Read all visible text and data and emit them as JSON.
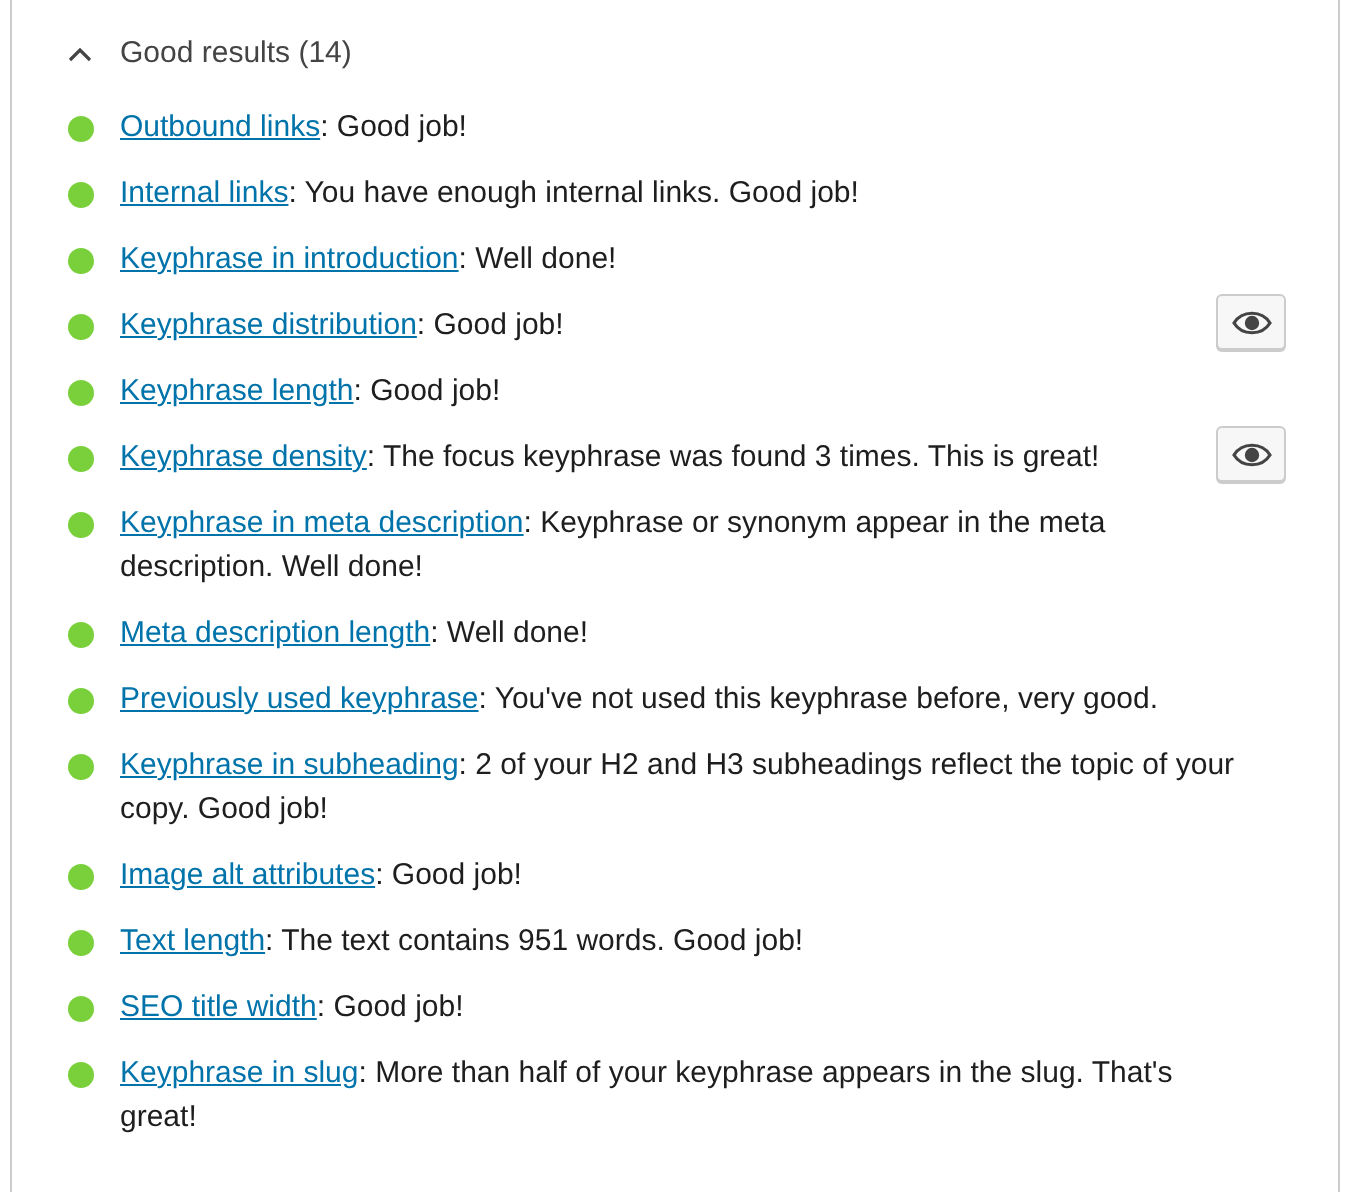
{
  "section": {
    "title": "Good results (14)",
    "expanded": true
  },
  "results": [
    {
      "link": "Outbound links",
      "text": ": Good job!",
      "color": "#7ad03a",
      "eye_button": false
    },
    {
      "link": "Internal links",
      "text": ": You have enough internal links. Good job!",
      "color": "#7ad03a",
      "eye_button": false
    },
    {
      "link": "Keyphrase in introduction",
      "text": ": Well done!",
      "color": "#7ad03a",
      "eye_button": false
    },
    {
      "link": "Keyphrase distribution",
      "text": ": Good job!",
      "color": "#7ad03a",
      "eye_button": true
    },
    {
      "link": "Keyphrase length",
      "text": ": Good job!",
      "color": "#7ad03a",
      "eye_button": false
    },
    {
      "link": "Keyphrase density",
      "text": ": The focus keyphrase was found 3 times. This is great!",
      "color": "#7ad03a",
      "eye_button": true
    },
    {
      "link": "Keyphrase in meta description",
      "text": ": Keyphrase or synonym appear in the meta description. Well done!",
      "color": "#7ad03a",
      "eye_button": false
    },
    {
      "link": "Meta description length",
      "text": ": Well done!",
      "color": "#7ad03a",
      "eye_button": false
    },
    {
      "link": "Previously used keyphrase",
      "text": ": You've not used this keyphrase before, very good.",
      "color": "#7ad03a",
      "eye_button": false
    },
    {
      "link": "Keyphrase in subheading",
      "text": ": 2 of your H2 and H3 subheadings reflect the topic of your copy. Good job!",
      "color": "#7ad03a",
      "eye_button": false
    },
    {
      "link": "Image alt attributes",
      "text": ": Good job!",
      "color": "#7ad03a",
      "eye_button": false
    },
    {
      "link": "Text length",
      "text": ": The text contains 951 words. Good job!",
      "color": "#7ad03a",
      "eye_button": false
    },
    {
      "link": "SEO title width",
      "text": ": Good job!",
      "color": "#7ad03a",
      "eye_button": false
    },
    {
      "link": "Keyphrase in slug",
      "text": ": More than half of your keyphrase appears in the slug. That's great!",
      "color": "#7ad03a",
      "eye_button": false
    }
  ]
}
